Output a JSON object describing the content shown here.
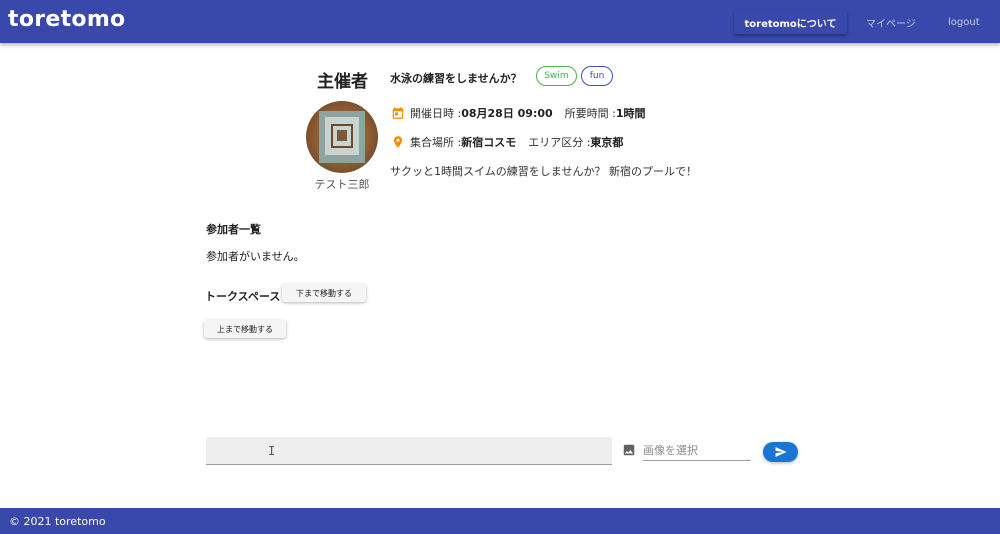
{
  "header": {
    "brand": "toretomo",
    "nav": {
      "about": "toretomoについて",
      "mypage": "マイページ",
      "logout": "logout"
    }
  },
  "host": {
    "label": "主催者",
    "name": "テスト三郎"
  },
  "event": {
    "title": "水泳の練習をしませんか？",
    "tags": [
      "Swim",
      "fun"
    ],
    "date_label": "開催日時 : ",
    "date_value": "08月28日 09:00",
    "duration_label": "所要時間 : ",
    "duration_value": "1時間",
    "place_label": "集合場所 : ",
    "place_value": "新宿コスモ",
    "area_label": "エリア区分 : ",
    "area_value": "東京都",
    "description": "サクッと1時間スイムの練習をしませんか？ 新宿のプールで！"
  },
  "participants": {
    "title": "参加者一覧",
    "empty_text": "参加者がいません。"
  },
  "talk": {
    "title": "トークスペース",
    "scroll_down_label": "下まで移動する",
    "scroll_up_label": "上まで移動する"
  },
  "composer": {
    "message_value": "",
    "file_placeholder": "画像を選択"
  },
  "footer": {
    "text": "© 2021 toretomo"
  },
  "colors": {
    "primary": "#3949ab",
    "send": "#1976d2",
    "chip_swim": "#4caf50",
    "chip_fun": "#3f51b5",
    "calendar_icon": "#fb8c00",
    "place_icon": "#fb8c00"
  },
  "icons": {
    "calendar": "calendar-icon",
    "place": "map-marker-icon",
    "image": "image-icon",
    "send": "send-icon"
  }
}
